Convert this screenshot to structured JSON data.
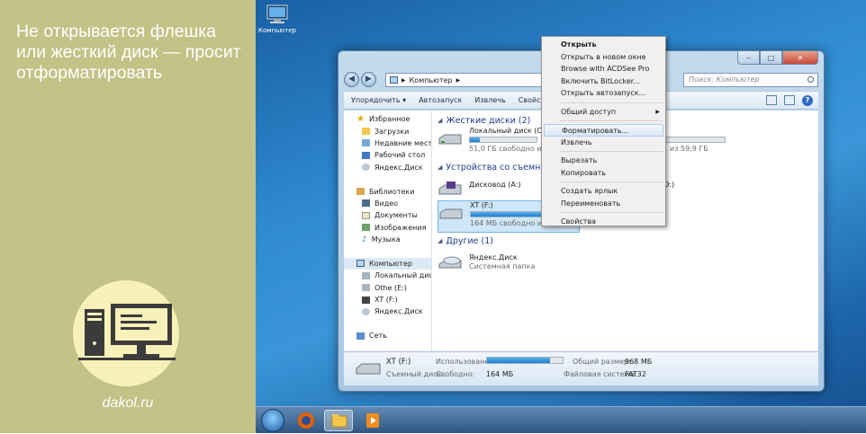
{
  "promo": {
    "title": "Не открывается флешка или жесткий диск — просит отформатировать",
    "site": "dakol.ru"
  },
  "desktop": {
    "icon_label": "Компьютер"
  },
  "window": {
    "address_items": [
      "Компьютер"
    ],
    "search_placeholder": "Поиск: Компьютер",
    "toolbar": [
      "Упорядочить ▾",
      "Автозапуск",
      "Извлечь",
      "Свойства"
    ]
  },
  "nav_pane": {
    "favorites": {
      "header": "Избранное",
      "items": [
        "Загрузки",
        "Недавние места",
        "Рабочий стол",
        "Яндекс.Диск"
      ]
    },
    "libraries": {
      "header": "Библиотеки",
      "items": [
        "Видео",
        "Документы",
        "Изображения",
        "Музыка"
      ]
    },
    "computer": {
      "header": "Компьютер",
      "items": [
        "Локальный диск (C",
        "Othe (E:)",
        "XT (F:)",
        "Яндекс.Диск"
      ]
    },
    "network": "Сеть"
  },
  "groups": {
    "hard_drives": "Жесткие диски (2)",
    "removable": "Устройства со съемными",
    "other": "Другие (1)"
  },
  "drives": {
    "c": {
      "name": "Локальный диск (C:)",
      "free": "51,0 ГБ свободно из 9",
      "used_fraction": 0.15
    },
    "e_free": "из 59,9 ГБ",
    "dvd": {
      "name": "Дисковод (A:)"
    },
    "dvd_d": "(D:)",
    "f": {
      "name": "XT (F:)",
      "free": "164 МБ свободно из 968 МБ",
      "used_fraction": 0.83
    },
    "yandex": {
      "name": "Яндекс.Диск",
      "sub": "Системная папка"
    }
  },
  "context_menu": {
    "items": [
      {
        "label": "Открыть",
        "bold": true
      },
      {
        "label": "Открыть в новом окне"
      },
      {
        "label": "Browse with ACDSee Pro"
      },
      {
        "label": "Включить BitLocker..."
      },
      {
        "label": "Открыть автозапуск..."
      },
      {
        "sep": true
      },
      {
        "label": "Общий доступ",
        "submenu": true
      },
      {
        "sep": true
      },
      {
        "label": "Форматировать...",
        "highlight": true
      },
      {
        "label": "Извлечь"
      },
      {
        "sep": true
      },
      {
        "label": "Вырезать"
      },
      {
        "label": "Копировать"
      },
      {
        "sep": true
      },
      {
        "label": "Создать ярлык"
      },
      {
        "label": "Переименовать"
      },
      {
        "sep": true
      },
      {
        "label": "Свойства"
      }
    ]
  },
  "details": {
    "name": "XT (F:)",
    "type": "Съемный диск",
    "used_label": "Использовано:",
    "free_label": "Свободно:",
    "free_value": "164 МБ",
    "total_label": "Общий размер:",
    "total_value": "968 МБ",
    "fs_label": "Файловая система:",
    "fs_value": "FAT32",
    "used_fraction": 0.83
  },
  "colors": {
    "promo_bg": "#c3c287",
    "accent": "#1e7fcc",
    "group_header": "#1e3c8c"
  }
}
